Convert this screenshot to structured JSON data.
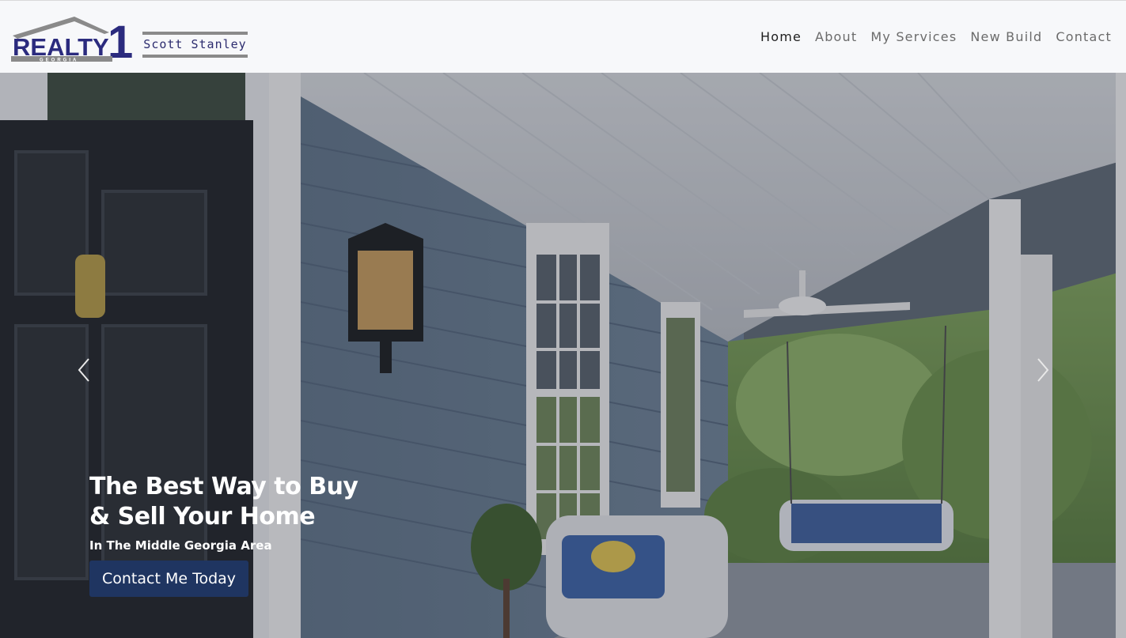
{
  "brand": {
    "logo_text": "REALTY",
    "logo_digit": "1",
    "logo_region": "GEORGIA",
    "agent_name": "Scott Stanley",
    "colors": {
      "navy": "#2b2b7e",
      "gray": "#8a8a8a"
    }
  },
  "nav": {
    "items": [
      {
        "label": "Home",
        "active": true
      },
      {
        "label": "About",
        "active": false
      },
      {
        "label": "My Services",
        "active": false
      },
      {
        "label": "New Build",
        "active": false
      },
      {
        "label": "Contact",
        "active": false
      }
    ]
  },
  "hero": {
    "headline_line1": "The Best Way to Buy",
    "headline_line2": "& Sell Your Home",
    "subheading": "In The Middle Georgia Area",
    "cta_label": "Contact Me Today",
    "cta_color": "#1f3561",
    "prev_icon": "chevron-left-icon",
    "next_icon": "chevron-right-icon"
  }
}
